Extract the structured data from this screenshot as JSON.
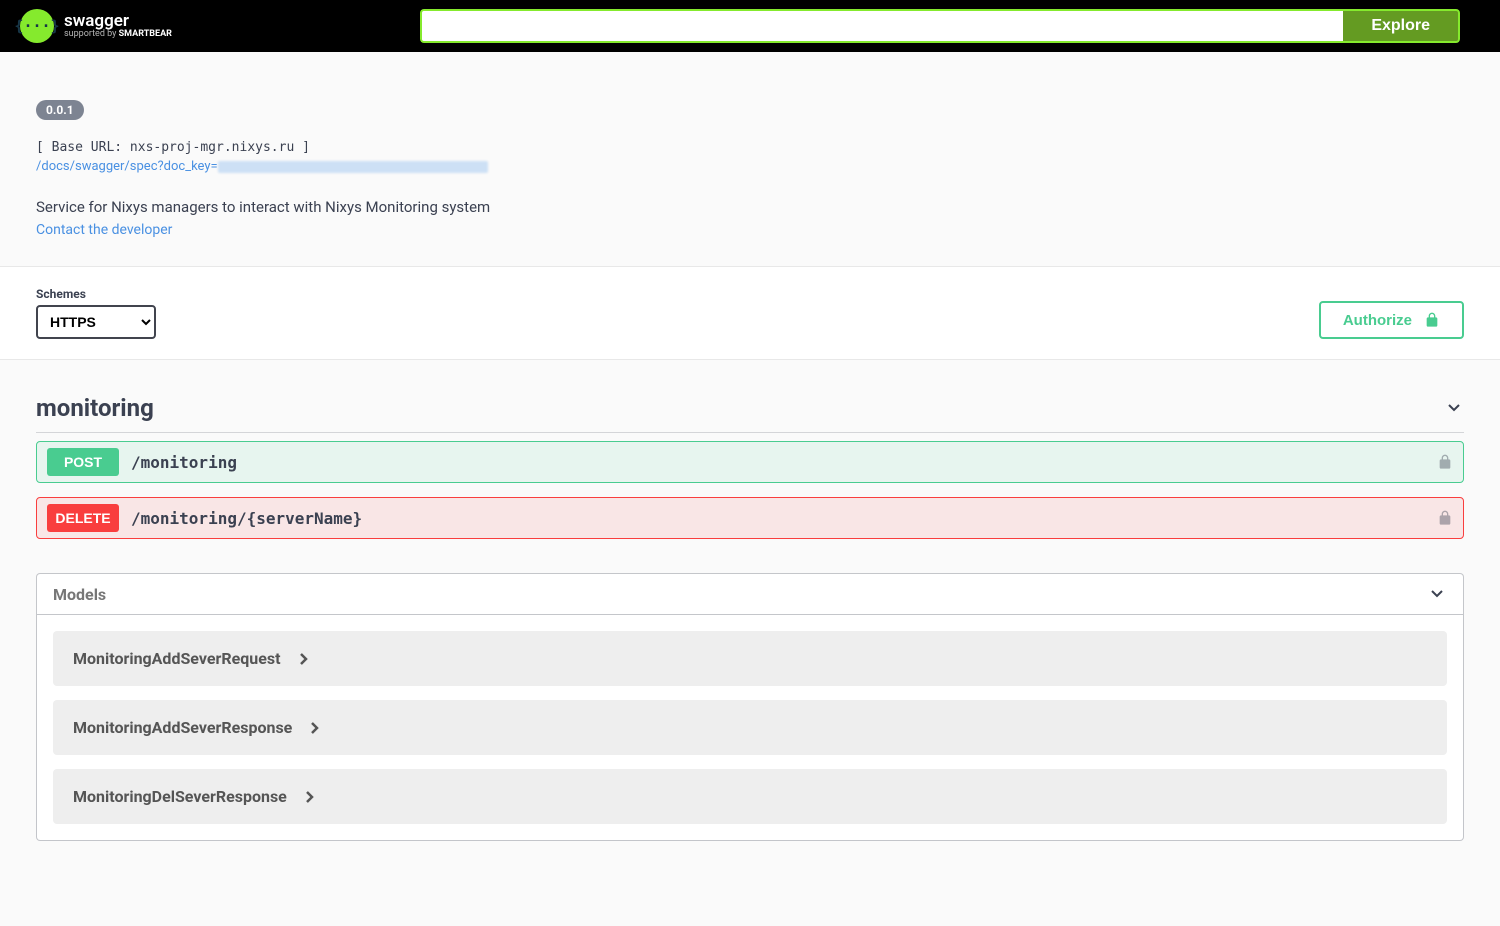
{
  "topbar": {
    "logo_title": "swagger",
    "logo_supported": "supported by",
    "logo_company": "SMARTBEAR",
    "explore": "Explore"
  },
  "info": {
    "version": "0.0.1",
    "base_url_label": "[ Base URL: nxs-proj-mgr.nixys.ru ]",
    "spec_link_prefix": "/docs/swagger/spec?doc_key=",
    "description": "Service for Nixys managers to interact with Nixys Monitoring system",
    "contact": "Contact the developer"
  },
  "schemes": {
    "label": "Schemes",
    "selected": "HTTPS",
    "authorize": "Authorize"
  },
  "tag": {
    "name": "monitoring"
  },
  "operations": [
    {
      "method": "POST",
      "path": "/monitoring"
    },
    {
      "method": "DELETE",
      "path": "/monitoring/{serverName}"
    }
  ],
  "models": {
    "title": "Models",
    "items": [
      "MonitoringAddSeverRequest",
      "MonitoringAddSeverResponse",
      "MonitoringDelSeverResponse"
    ]
  }
}
